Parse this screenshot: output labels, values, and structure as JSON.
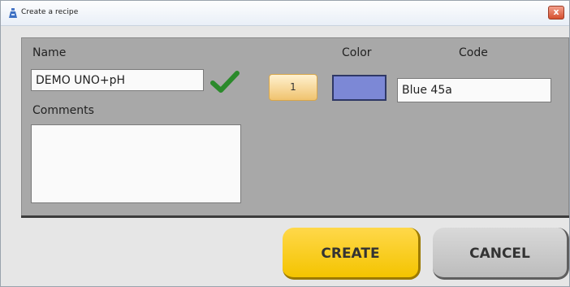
{
  "window": {
    "title": "Create a recipe",
    "close_label": "x"
  },
  "form": {
    "name_label": "Name",
    "name_value": "DEMO UNO+pH",
    "comments_label": "Comments",
    "comments_value": "",
    "color_label": "Color",
    "code_label": "Code",
    "number_button_label": "1",
    "color_value": "#7c88d6",
    "code_value": "Blue 45a"
  },
  "buttons": {
    "create_label": "CREATE",
    "cancel_label": "CANCEL"
  },
  "icons": {
    "app": "recipe-app-icon",
    "check": "checkmark-icon",
    "close": "close-icon"
  }
}
